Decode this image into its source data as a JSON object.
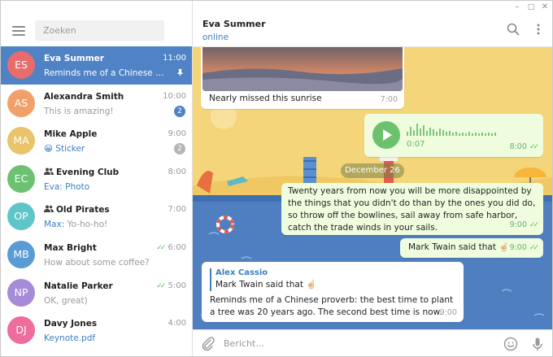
{
  "window": {
    "controls": [
      "–",
      "□",
      "✕"
    ]
  },
  "sidebar": {
    "search_placeholder": "Zoeken",
    "chats": [
      {
        "initials": "ES",
        "name": "Eva Summer",
        "time": "11:00",
        "preview": "Reminds me of a Chinese prove...",
        "color": "#e96c6c",
        "active": true,
        "pinned": true
      },
      {
        "initials": "AS",
        "name": "Alexandra Smith",
        "time": "10:00",
        "preview": "This is amazing!",
        "color": "#f2a06a",
        "badge": "2",
        "badge_color": "#4f83c5"
      },
      {
        "initials": "MA",
        "name": "Mike Apple",
        "time": "9:00",
        "preview_emoji": "😀",
        "preview": "Sticker",
        "preview_highlight": true,
        "color": "#e9c46a",
        "badge": "2",
        "badge_color": "#b5b5b5"
      },
      {
        "initials": "EC",
        "name": "Evening Club",
        "time": "8:00",
        "group": true,
        "preview_sender": "Eva:",
        "preview": "Photo",
        "color": "#6cc272"
      },
      {
        "initials": "OP",
        "name": "Old Pirates",
        "time": "7:00",
        "group": true,
        "preview_sender": "Max:",
        "preview": "Yo-ho-ho!",
        "color": "#5ec6c9"
      },
      {
        "initials": "MB",
        "name": "Max Bright",
        "time": "6:00",
        "preview": "How about some coffee?",
        "color": "#5b9bd5",
        "read": true
      },
      {
        "initials": "NP",
        "name": "Natalie Parker",
        "time": "5:00",
        "preview": "OK, great)",
        "color": "#a58bd8",
        "read": true
      },
      {
        "initials": "DJ",
        "name": "Davy Jones",
        "time": "4:00",
        "preview": "Keynote.pdf",
        "preview_highlight": true,
        "color": "#ee6d9c"
      }
    ]
  },
  "header": {
    "name": "Eva Summer",
    "status": "online"
  },
  "messages": {
    "photo_caption": "Nearly missed this sunrise",
    "photo_time": "7:00",
    "voice_duration": "0:07",
    "voice_time": "8:00",
    "date_divider": "December 26",
    "quote_text": "Twenty years from now you will be more disappointed by the things that you didn't do than by the ones you did do, so throw off the bowlines, sail away from safe harbor, catch the trade winds in your sails.",
    "quote_time": "9:00",
    "twain_text": "Mark Twain said that",
    "twain_emoji": "☝🏻",
    "twain_time": "9:00",
    "reply_author": "Alex Cassio",
    "reply_quoted": "Mark Twain said that",
    "reply_quoted_emoji": "☝🏻",
    "reply_text": "Reminds me of a Chinese proverb: the best time to plant a tree was 20 years ago. The second best time is now.",
    "reply_time": "9:00"
  },
  "composer": {
    "placeholder": "Bericht..."
  },
  "colors": {
    "accent": "#4f83c5",
    "link": "#3d7ec0",
    "outgoing_bubble": "#effdde",
    "read_check": "#5db75d"
  },
  "icons": [
    "menu-icon",
    "search-icon",
    "more-vert-icon",
    "pin-icon",
    "group-icon",
    "double-check-icon",
    "play-icon",
    "attach-icon",
    "emoji-icon",
    "microphone-icon"
  ]
}
